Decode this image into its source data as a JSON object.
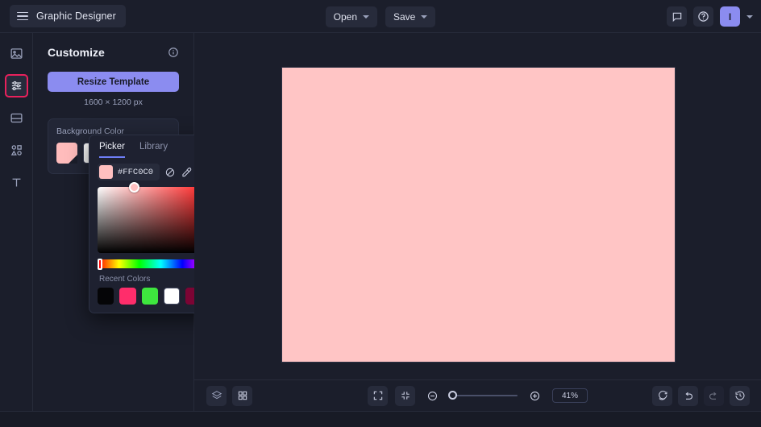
{
  "topbar": {
    "brand_label": "Graphic Designer",
    "menus": [
      {
        "label": "Open"
      },
      {
        "label": "Save"
      }
    ],
    "comment_icon": "comment-icon",
    "help_icon": "help-icon",
    "avatar_initial": "I"
  },
  "rail": {
    "items": [
      {
        "name": "images",
        "icon": "image-icon",
        "active": false
      },
      {
        "name": "customize",
        "icon": "sliders-icon",
        "active": true
      },
      {
        "name": "layout",
        "icon": "layout-icon",
        "active": false
      },
      {
        "name": "shapes",
        "icon": "shapes-icon",
        "active": false
      },
      {
        "name": "text",
        "icon": "text-icon",
        "active": false
      }
    ],
    "active_accent": "#e9215c"
  },
  "panel": {
    "title": "Customize",
    "info_icon": "info-icon",
    "resize_label": "Resize Template",
    "resize_accent": "#8b8cf0",
    "dimensions": "1600 × 1200 px",
    "background": {
      "label": "Background Color",
      "swatches": [
        {
          "color": "#ffbcbc",
          "selected": true
        },
        {
          "color": "#ffffff",
          "selected": false
        },
        {
          "color": "#cc1133",
          "selected": false
        },
        {
          "color": "#d8a21c",
          "selected": false
        }
      ]
    }
  },
  "picker": {
    "tabs": [
      {
        "label": "Picker",
        "active": true
      },
      {
        "label": "Library",
        "active": false
      }
    ],
    "hex_value": "#FFC0C0",
    "current_color": "#ffc0c0",
    "tools": [
      {
        "name": "no-color-icon"
      },
      {
        "name": "eyedropper-icon"
      },
      {
        "name": "palette-grid-icon"
      },
      {
        "name": "add-color-icon"
      }
    ],
    "hue_degrees": 0,
    "recent_label": "Recent Colors",
    "recent_colors": [
      "#050507",
      "#ff2d6b",
      "#3ee63e",
      "#ffffff",
      "#7c0434",
      "#f9b4e8"
    ]
  },
  "canvas": {
    "artboard_color": "#ffc5c5"
  },
  "bottombar": {
    "left_tools": [
      {
        "name": "layers-icon"
      },
      {
        "name": "grid-icon"
      }
    ],
    "fit_tools": [
      {
        "name": "fit-screen-icon"
      },
      {
        "name": "fit-content-icon"
      }
    ],
    "zoom_out_icon": "zoom-out-icon",
    "zoom_in_icon": "zoom-in-icon",
    "zoom_level": "41%",
    "right_tools": [
      {
        "name": "reset-icon",
        "disabled": false
      },
      {
        "name": "undo-icon",
        "disabled": false
      },
      {
        "name": "redo-icon",
        "disabled": true
      },
      {
        "name": "history-icon",
        "disabled": false
      }
    ]
  }
}
